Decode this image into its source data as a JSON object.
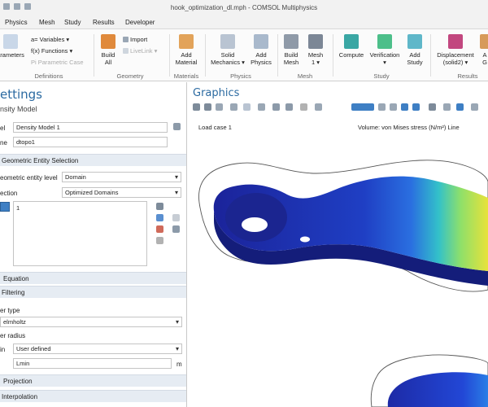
{
  "window": {
    "title": "hook_optimization_dl.mph - COMSOL Multiphysics"
  },
  "menu": {
    "tabs": [
      "Physics",
      "Mesh",
      "Study",
      "Results",
      "Developer"
    ]
  },
  "ribbon": {
    "parameters_label": "arameters",
    "variables_label": "a= Variables ▾",
    "functions_label": "f(x) Functions ▾",
    "parametric_case_label": "Pi Parametric Case",
    "build_all": [
      "Build",
      "All"
    ],
    "import_label": "Import",
    "livelink_label": "LiveLink ▾",
    "add_material": [
      "Add",
      "Material"
    ],
    "solid_mechanics": [
      "Solid",
      "Mechanics ▾"
    ],
    "add_physics": [
      "Add",
      "Physics"
    ],
    "build_mesh": [
      "Build",
      "Mesh"
    ],
    "mesh_1": [
      "Mesh",
      "1 ▾"
    ],
    "compute": "Compute",
    "verification": [
      "Verification",
      "▾"
    ],
    "add_study": [
      "Add",
      "Study"
    ],
    "displacement": [
      "Displacement",
      "(solid2) ▾"
    ],
    "more": [
      "A",
      "G"
    ],
    "groups": {
      "definitions": "Definitions",
      "geometry": "Geometry",
      "materials": "Materials",
      "physics": "Physics",
      "mesh": "Mesh",
      "study": "Study",
      "results": "Results"
    }
  },
  "settings": {
    "header": "ettings",
    "subheader": "nsity Model",
    "label_field": "el",
    "label_value": "Density Model 1",
    "name_field": "ne",
    "name_value": "dtopo1",
    "geo_section": "Geometric Entity Selection",
    "entity_level_label": "eometric entity level",
    "entity_level_value": "Domain",
    "selection_label": "ection",
    "selection_value": "Optimized Domains",
    "list_item": "1",
    "equation_section": "Equation",
    "filtering_section": "Filtering",
    "filter_type_label": "er type",
    "filter_type_value": "elmholtz",
    "filter_radius_label": "er radius",
    "radius_row_label": "in",
    "radius_value": "User defined",
    "length_value": "Lmin",
    "unit": "m",
    "projection_section": "Projection",
    "interpolation_section": "Interpolation"
  },
  "graphics": {
    "header": "Graphics",
    "load_case": "Load case 1",
    "volume_title": "Volume: von Mises stress (N/m²)  Line"
  },
  "colors": {
    "accent": "#2b6aa1",
    "section_bg": "#e6ecf3",
    "hook_dark": "#1c2a9e",
    "hook_mid": "#2453d6"
  }
}
